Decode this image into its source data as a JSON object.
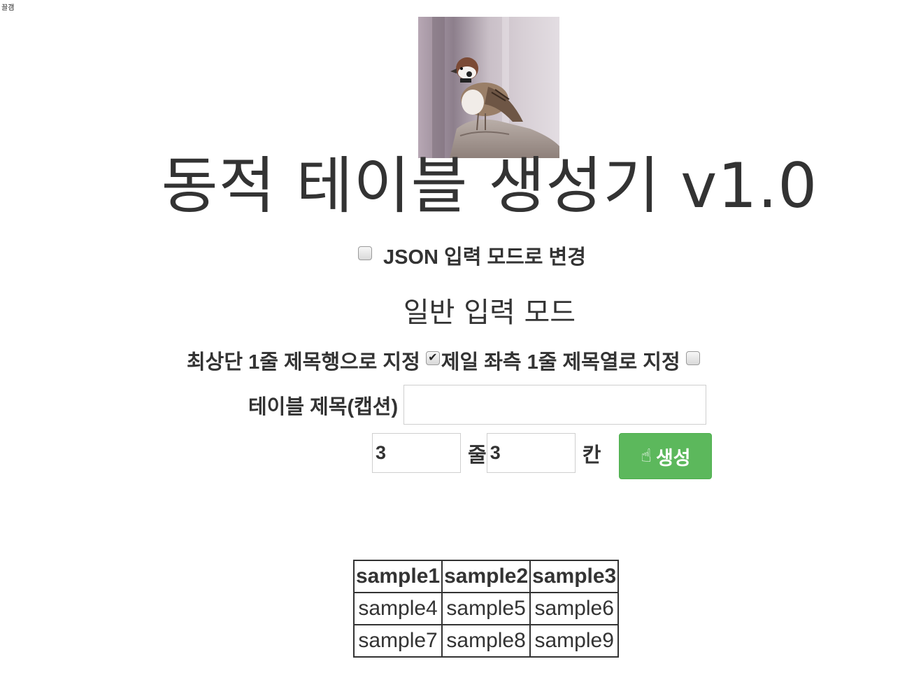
{
  "corner_label": "끌갬",
  "logo": {
    "icon": "sparrow-photo"
  },
  "title": "동적 테이블 생성기 v1.0",
  "json_mode": {
    "label": "JSON 입력 모드로 변경",
    "checked": false
  },
  "section_title": "일반 입력 모드",
  "options": {
    "header_row_label": "최상단 1줄 제목행으로 지정",
    "header_row_checked": true,
    "header_col_label": "제일 좌측 1줄 제목열로 지정",
    "header_col_checked": false
  },
  "caption": {
    "label": "테이블 제목(캡션)",
    "value": "",
    "placeholder": ""
  },
  "size": {
    "rows_value": "3",
    "rows_unit": "줄",
    "cols_value": "3",
    "cols_unit": "칸"
  },
  "generate_button": {
    "label": "생성",
    "icon": "hand-pointer-icon",
    "color": "#5cb85c"
  },
  "table": {
    "header": [
      "sample1",
      "sample2",
      "sample3"
    ],
    "rows": [
      [
        "sample4",
        "sample5",
        "sample6"
      ],
      [
        "sample7",
        "sample8",
        "sample9"
      ]
    ]
  }
}
